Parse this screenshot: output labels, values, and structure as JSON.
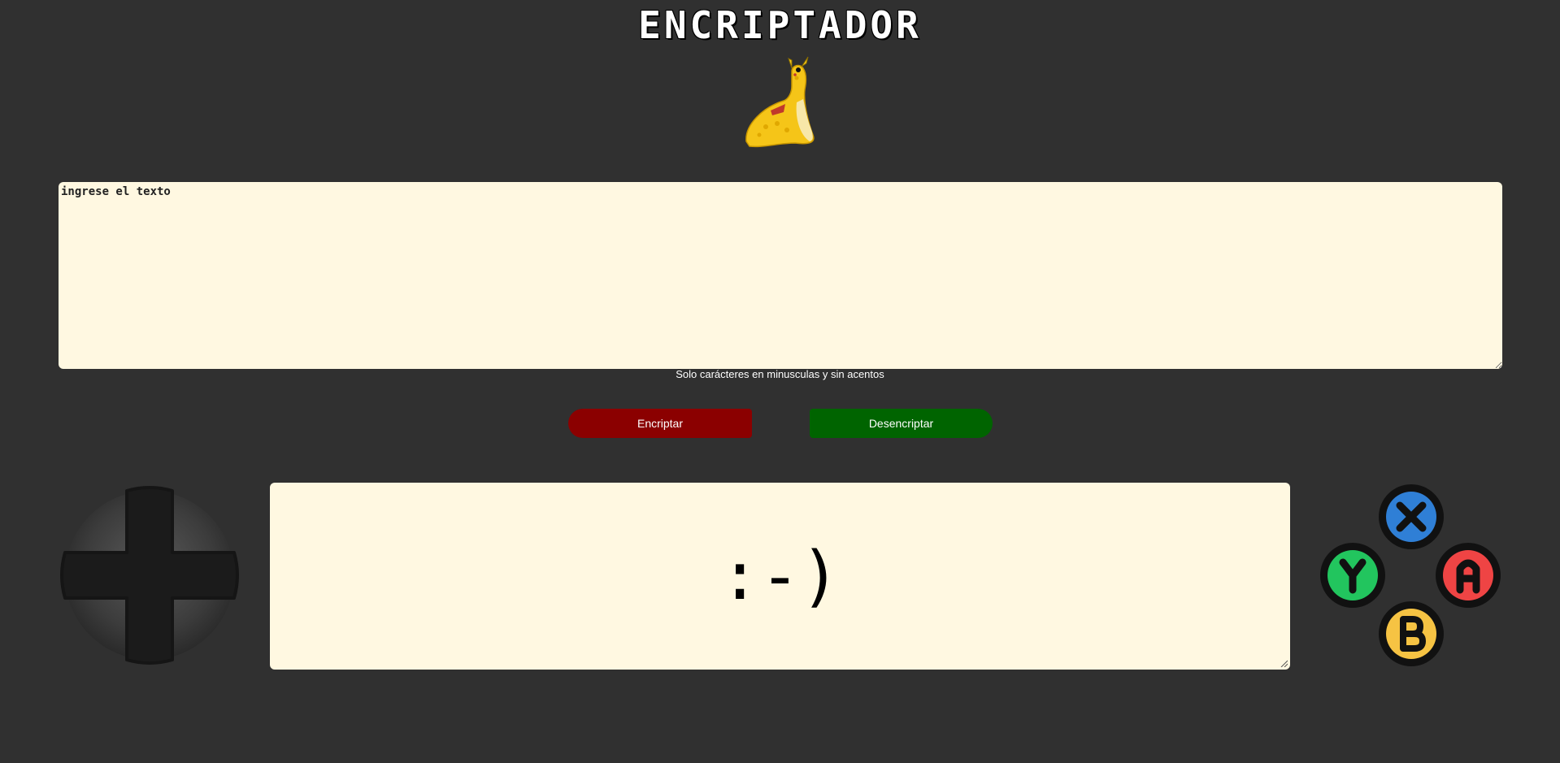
{
  "header": {
    "title": "ENCRIPTADOR"
  },
  "input": {
    "placeholder": "ingrese el texto",
    "value": ""
  },
  "hint_text": "Solo carácteres en minusculas y sin acentos",
  "buttons": {
    "encrypt_label": "Encriptar",
    "decrypt_label": "Desencriptar"
  },
  "output": {
    "text": ":-)"
  },
  "controller": {
    "face_buttons": [
      {
        "label": "X",
        "color": "#2f7fd6"
      },
      {
        "label": "Y",
        "color": "#22c55e"
      },
      {
        "label": "A",
        "color": "#ef4444"
      },
      {
        "label": "B",
        "color": "#f6c343"
      }
    ]
  },
  "colors": {
    "background": "#303030",
    "panel": "#fff8e1",
    "encrypt": "#8b0000",
    "decrypt": "#006400"
  }
}
